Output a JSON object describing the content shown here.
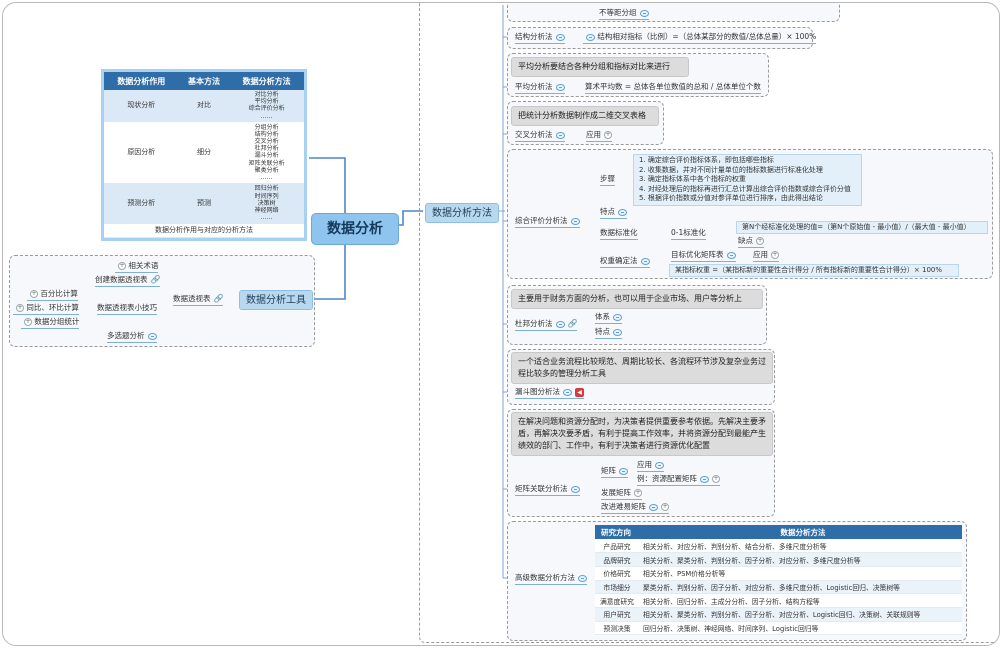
{
  "central": "数据分析",
  "branches": {
    "methods": "数据分析方法",
    "tools": "数据分析工具"
  },
  "left_table": {
    "headers": [
      "数据分析作用",
      "基本方法",
      "数据分析方法"
    ],
    "rows": [
      {
        "purpose": "现状分析",
        "basic": "对比",
        "methods": [
          "对比分析",
          "平均分析",
          "综合评价分析",
          "……"
        ]
      },
      {
        "purpose": "原因分析",
        "basic": "细分",
        "methods": [
          "分组分析",
          "结构分析",
          "交叉分析",
          "杜邦分析",
          "漏斗分析",
          "矩阵关联分析",
          "聚类分析",
          "……"
        ]
      },
      {
        "purpose": "预测分析",
        "basic": "预测",
        "methods": [
          "回归分析",
          "时间序列",
          "决策树",
          "神经网络",
          "……"
        ]
      }
    ],
    "caption": "数据分析作用与对应的分析方法"
  },
  "tools": {
    "pivot": "数据透视表",
    "related": "相关术语",
    "create": "创建数据透视表",
    "tips": "数据透视表小技巧",
    "percent": "百分比计算",
    "yoy": "同比、环比计算",
    "group": "数据分组统计",
    "multi": "多选题分析"
  },
  "methods": {
    "top_partial": "不等距分组",
    "structure": {
      "label": "结构分析法",
      "formula": "结构相对指标（比例）=（总体某部分的数值/总体总量）× 100%"
    },
    "average": {
      "callout": "平均分析要结合各种分组和指标对比来进行",
      "label": "平均分析法",
      "formula": "算术平均数 = 总体各单位数值的总和 / 总体单位个数"
    },
    "cross": {
      "callout": "把统计分析数据制作成二维交叉表格",
      "label": "交叉分析法",
      "app": "应用"
    },
    "comprehensive": {
      "label": "综合评价分析法",
      "steps_label": "步骤",
      "steps": [
        "1. 确定综合评价指标体系，即包括哪些指标",
        "2. 收集数据，并对不同计量单位的指标数据进行标准化处理",
        "3. 确定指标体系中各个指标的权重",
        "4. 对经处理后的指标再进行汇总计算出综合评价指数或综合评价分值",
        "5. 根据评价指数或分值对参评单位进行排序，由此得出结论"
      ],
      "features": "特点",
      "normalize": "数据标准化",
      "zero_one": "0-1标准化",
      "zero_one_formula": "第N个经标准化处理的值=（第N个原始值 - 最小值）/（最大值 - 最小值）",
      "drawback": "缺点",
      "weight": "权重确定法",
      "goal_matrix": "目标优化矩阵表",
      "app": "应用",
      "weight_formula": "某指标权重 =（某指标新的重要性合计得分 / 所有指标新的重要性合计得分）× 100%"
    },
    "dupont": {
      "callout": "主要用于财务方面的分析，也可以用于企业市场、用户等分析上",
      "label": "杜邦分析法",
      "system": "体系",
      "features": "特点"
    },
    "funnel": {
      "callout": "一个适合业务流程比较规范、周期比较长、各流程环节涉及复杂业务过程比较多的管理分析工具",
      "label": "漏斗图分析法"
    },
    "matrix": {
      "callout": "在解决问题和资源分配时，为决策者提供重要参考依据。先解决主要矛盾，再解决次要矛盾，有利于提高工作效率，并将资源分配到最能产生绩效的部门、工作中，有利于决策者进行资源优化配置",
      "label": "矩阵关联分析法",
      "matrix": "矩阵",
      "app": "应用",
      "example": "例：资源配置矩阵",
      "dev_matrix": "发展矩阵",
      "improve_matrix": "改进难易矩阵"
    },
    "advanced": {
      "label": "高级数据分析方法",
      "headers": [
        "研究方向",
        "数据分析方法"
      ],
      "rows": [
        [
          "产品研究",
          "相关分析、对应分析、判别分析、结合分析、多维尺度分析等"
        ],
        [
          "品牌研究",
          "相关分析、聚类分析、判别分析、因子分析、对应分析、多维尺度分析等"
        ],
        [
          "价格研究",
          "相关分析、PSM价格分析等"
        ],
        [
          "市场细分",
          "聚类分析、判别分析、因子分析、对应分析、多维尺度分析、Logistic回归、决策树等"
        ],
        [
          "满意度研究",
          "相关分析、回归分析、主成分分析、因子分析、结构方程等"
        ],
        [
          "用户研究",
          "相关分析、聚类分析、判别分析、因子分析、对应分析、Logistic回归、决策树、关联规则等"
        ],
        [
          "预测决策",
          "回归分析、决策树、神经网络、时间序列、Logistic回归等"
        ]
      ]
    }
  }
}
